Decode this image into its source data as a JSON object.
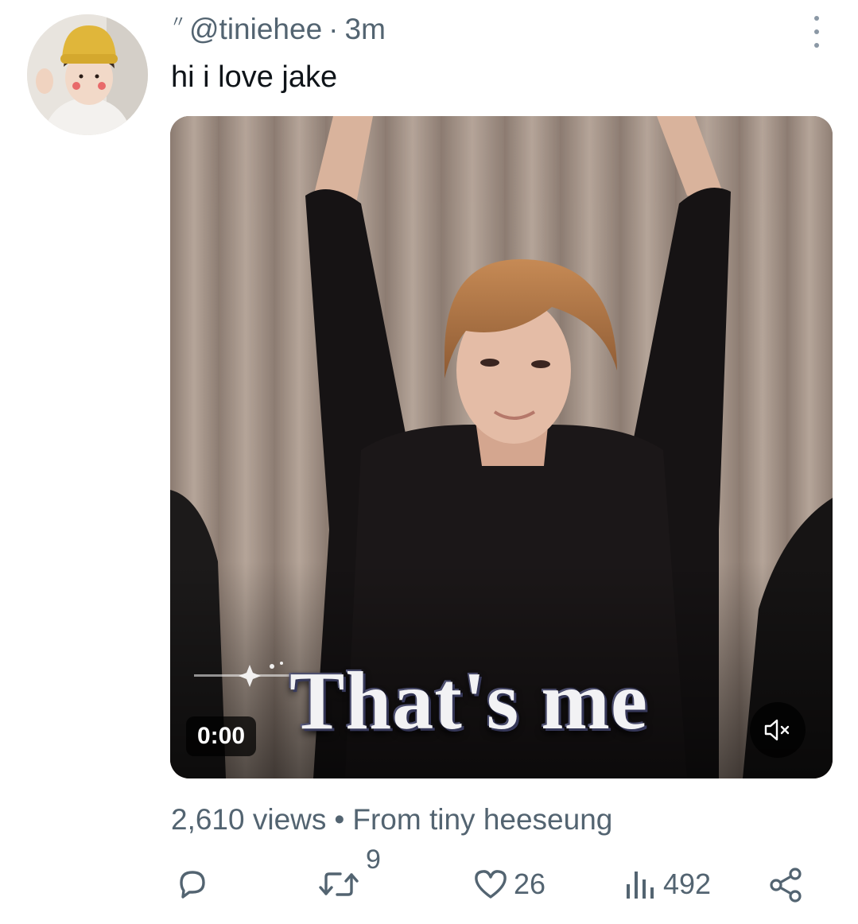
{
  "tweet": {
    "handle": "@tiniehee",
    "separator": "·",
    "time": "3m",
    "text": "hi i love jake",
    "avatar_icon": "profile-photo"
  },
  "media": {
    "timestamp": "0:00",
    "caption": "That's me",
    "mute_icon": "speaker-muted-icon"
  },
  "meta": {
    "views": "2,610 views",
    "dot": "•",
    "source": "From tiny heeseung"
  },
  "actions": {
    "reply_icon": "reply-icon",
    "retweet_icon": "retweet-icon",
    "retweet_count": "9",
    "like_icon": "heart-icon",
    "like_count": "26",
    "views_icon": "analytics-icon",
    "views_count": "492",
    "share_icon": "share-icon"
  },
  "colors": {
    "text_primary": "#0f1419",
    "text_secondary": "#536471"
  }
}
